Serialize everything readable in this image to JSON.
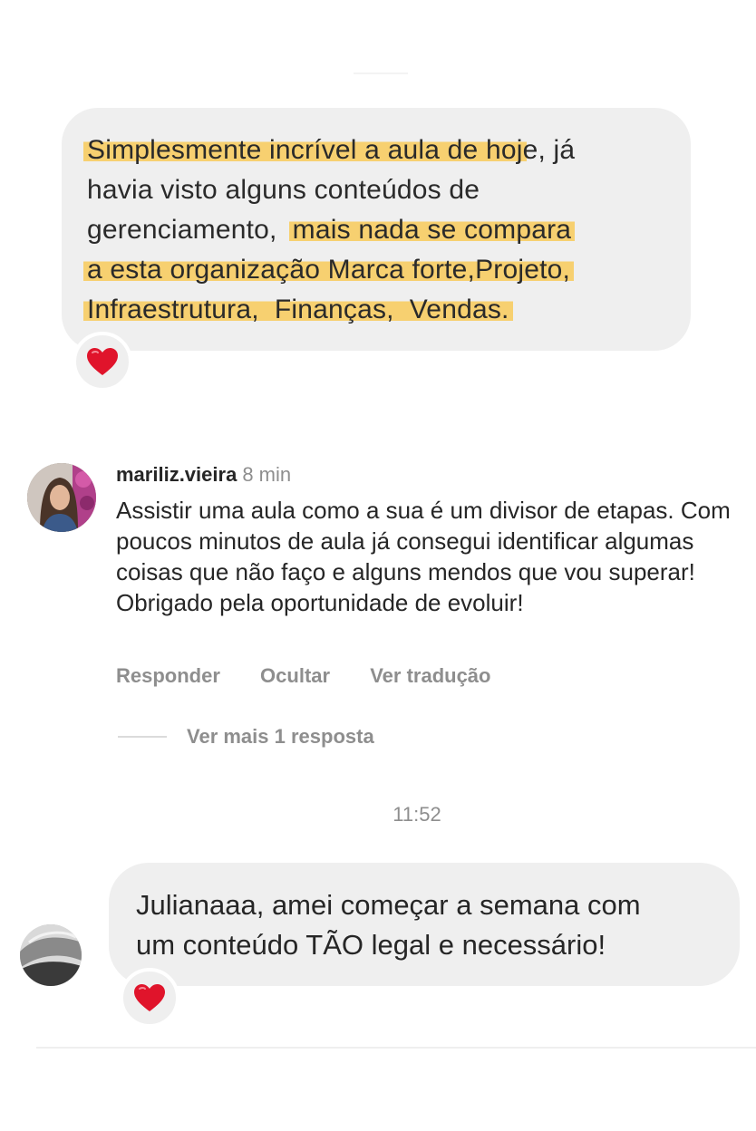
{
  "quoted_message": {
    "lines": [
      {
        "highlight": "Simplesmente incrível a aula de hoj",
        "rest": "e, já"
      },
      {
        "text": "havia visto alguns conteúdos de"
      },
      {
        "plain": "gerenciamento,  ",
        "highlight": "mais nada se compara"
      },
      {
        "highlight": "a esta organização Marca forte,Projeto,"
      },
      {
        "highlight": "Infraestrutura,  Finanças,  Vendas."
      }
    ],
    "reaction": "red-heart"
  },
  "comment": {
    "username": "mariliz.vieira",
    "time_ago": "8 min",
    "text": "Assistir uma aula como a sua é um divisor de etapas. Com poucos minutos de aula já consegui identificar algumas coisas que não faço e alguns mendos que vou superar! Obrigado pela oportunidade de evoluir!",
    "actions": {
      "reply": "Responder",
      "hide": "Ocultar",
      "translate": "Ver tradução"
    },
    "more_replies": "Ver mais 1 resposta"
  },
  "timestamp": "11:52",
  "message": {
    "line1": "Julianaaa, amei começar a semana com",
    "line2": "um conteúdo TÃO legal e necessário!",
    "reaction": "red-heart"
  },
  "colors": {
    "bubble": "#efefef",
    "highlight": "#f7d070",
    "muted_text": "#8e8e8e",
    "heart": "#e0142b"
  }
}
